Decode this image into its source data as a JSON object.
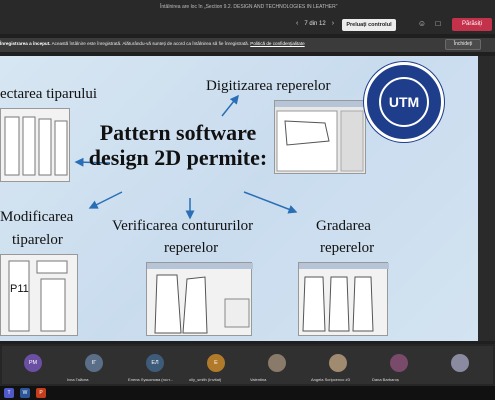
{
  "meeting": {
    "title": "Întâlnirea are loc în „Section 9.2. DESIGN AND TECHNOLOGIES IN LEATHER”"
  },
  "toolbar": {
    "page_indicator": "7 din 12",
    "take_control_label": "Preluați controlul",
    "leave_label": "Părăsiți",
    "icons": [
      "people-icon",
      "chat-icon",
      "reactions-icon",
      "more-icon",
      "camera-icon",
      "mic-icon",
      "share-icon"
    ]
  },
  "banner": {
    "bold_text": "Înregistrarea a început.",
    "text": "Această întâlnire este înregistrată. Alăturându-vă sunteți de acord ca întâlnirea să fie înregistrată.",
    "link_text": "Politică de confidențialitate",
    "close_label": "Închideți"
  },
  "slide": {
    "main_title": "Pattern software design 2D permite:",
    "labels": {
      "top_left": "ectarea tiparului",
      "top_right": "Digitizarea reperelor",
      "mid_left_1": "Modificarea",
      "mid_left_2": "tiparelor",
      "bottom_center_1": "Verificarea contururilor",
      "bottom_center_2": "reperelor",
      "bottom_right_1": "Gradarea",
      "bottom_right_2": "reperelor",
      "thumb_label": "P11"
    },
    "logo_text": "UTM"
  },
  "participants": [
    {
      "initials": "PM",
      "name": "",
      "color": "#6b4fa3"
    },
    {
      "initials": "ІГ",
      "name": "Ivna Гайсна",
      "color": "#5a6e88"
    },
    {
      "initials": "ЕЛ",
      "name": "Елена Лукьянова (гост...",
      "color": "#3d5c7a"
    },
    {
      "initials": "E",
      "name": "olly_smith (Invitat)",
      "color": "#b07a2a"
    },
    {
      "initials": "",
      "name": "Valentina",
      "color": "#8a7a6a"
    },
    {
      "initials": "",
      "name": "Angela Scripcenco #3",
      "color": "#a08a70"
    },
    {
      "initials": "",
      "name": "Dana Barbaroș",
      "color": "#7a4a6a"
    },
    {
      "initials": "",
      "name": "",
      "color": "#8a8aa0"
    }
  ],
  "taskbar": {
    "icons": [
      "teams-icon",
      "word-icon",
      "powerpoint-icon"
    ]
  }
}
